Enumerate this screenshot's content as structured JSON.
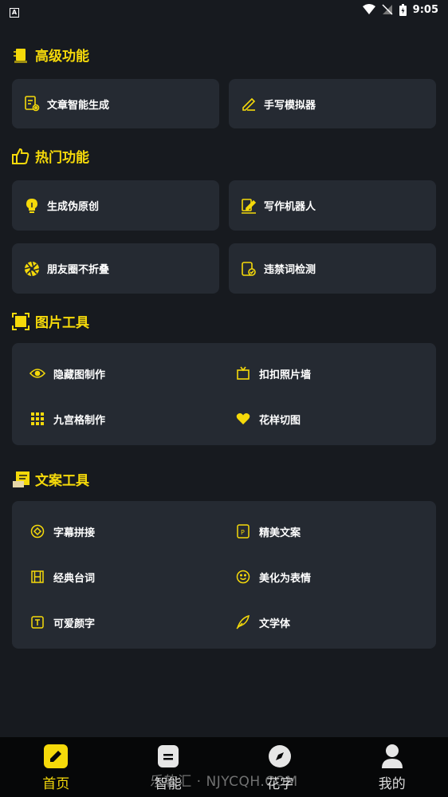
{
  "status_bar": {
    "time": "9:05",
    "notification": "A"
  },
  "colors": {
    "accent": "#f5d90a",
    "card": "#252a32",
    "background": "#171a1f"
  },
  "sections": {
    "advanced": {
      "title": "高级功能",
      "icon": "notebook-icon",
      "items": [
        {
          "label": "文章智能生成",
          "icon": "document-gear-icon"
        },
        {
          "label": "手写模拟器",
          "icon": "pen-icon"
        }
      ]
    },
    "hot": {
      "title": "热门功能",
      "icon": "thumbs-up-icon",
      "items": [
        {
          "label": "生成伪原创",
          "icon": "lightbulb-icon"
        },
        {
          "label": "写作机器人",
          "icon": "writing-robot-icon"
        },
        {
          "label": "朋友圈不折叠",
          "icon": "aperture-icon"
        },
        {
          "label": "违禁词检测",
          "icon": "shield-check-icon"
        }
      ]
    },
    "image_tools": {
      "title": "图片工具",
      "icon": "frame-icon",
      "items": [
        {
          "label": "隐藏图制作",
          "icon": "eye-icon"
        },
        {
          "label": "扣扣照片墙",
          "icon": "tv-frame-icon"
        },
        {
          "label": "九宫格制作",
          "icon": "grid-icon"
        },
        {
          "label": "花样切图",
          "icon": "heart-icon"
        }
      ]
    },
    "copy_tools": {
      "title": "文案工具",
      "icon": "note-icon",
      "items": [
        {
          "label": "字幕拼接",
          "icon": "subtitle-icon"
        },
        {
          "label": "精美文案",
          "icon": "copy-tag-icon"
        },
        {
          "label": "经典台词",
          "icon": "film-icon"
        },
        {
          "label": "美化为表情",
          "icon": "smiley-icon"
        },
        {
          "label": "可爱颜字",
          "icon": "text-box-icon"
        },
        {
          "label": "文学体",
          "icon": "quill-icon"
        }
      ]
    }
  },
  "bottom_nav": [
    {
      "label": "首页",
      "icon": "pencil-icon",
      "active": true
    },
    {
      "label": "智能",
      "icon": "document-icon",
      "active": false
    },
    {
      "label": "花字",
      "icon": "compass-icon",
      "active": false
    },
    {
      "label": "我的",
      "icon": "user-icon",
      "active": false
    }
  ],
  "watermark": "乐软汇 · NJYCQH.COM"
}
